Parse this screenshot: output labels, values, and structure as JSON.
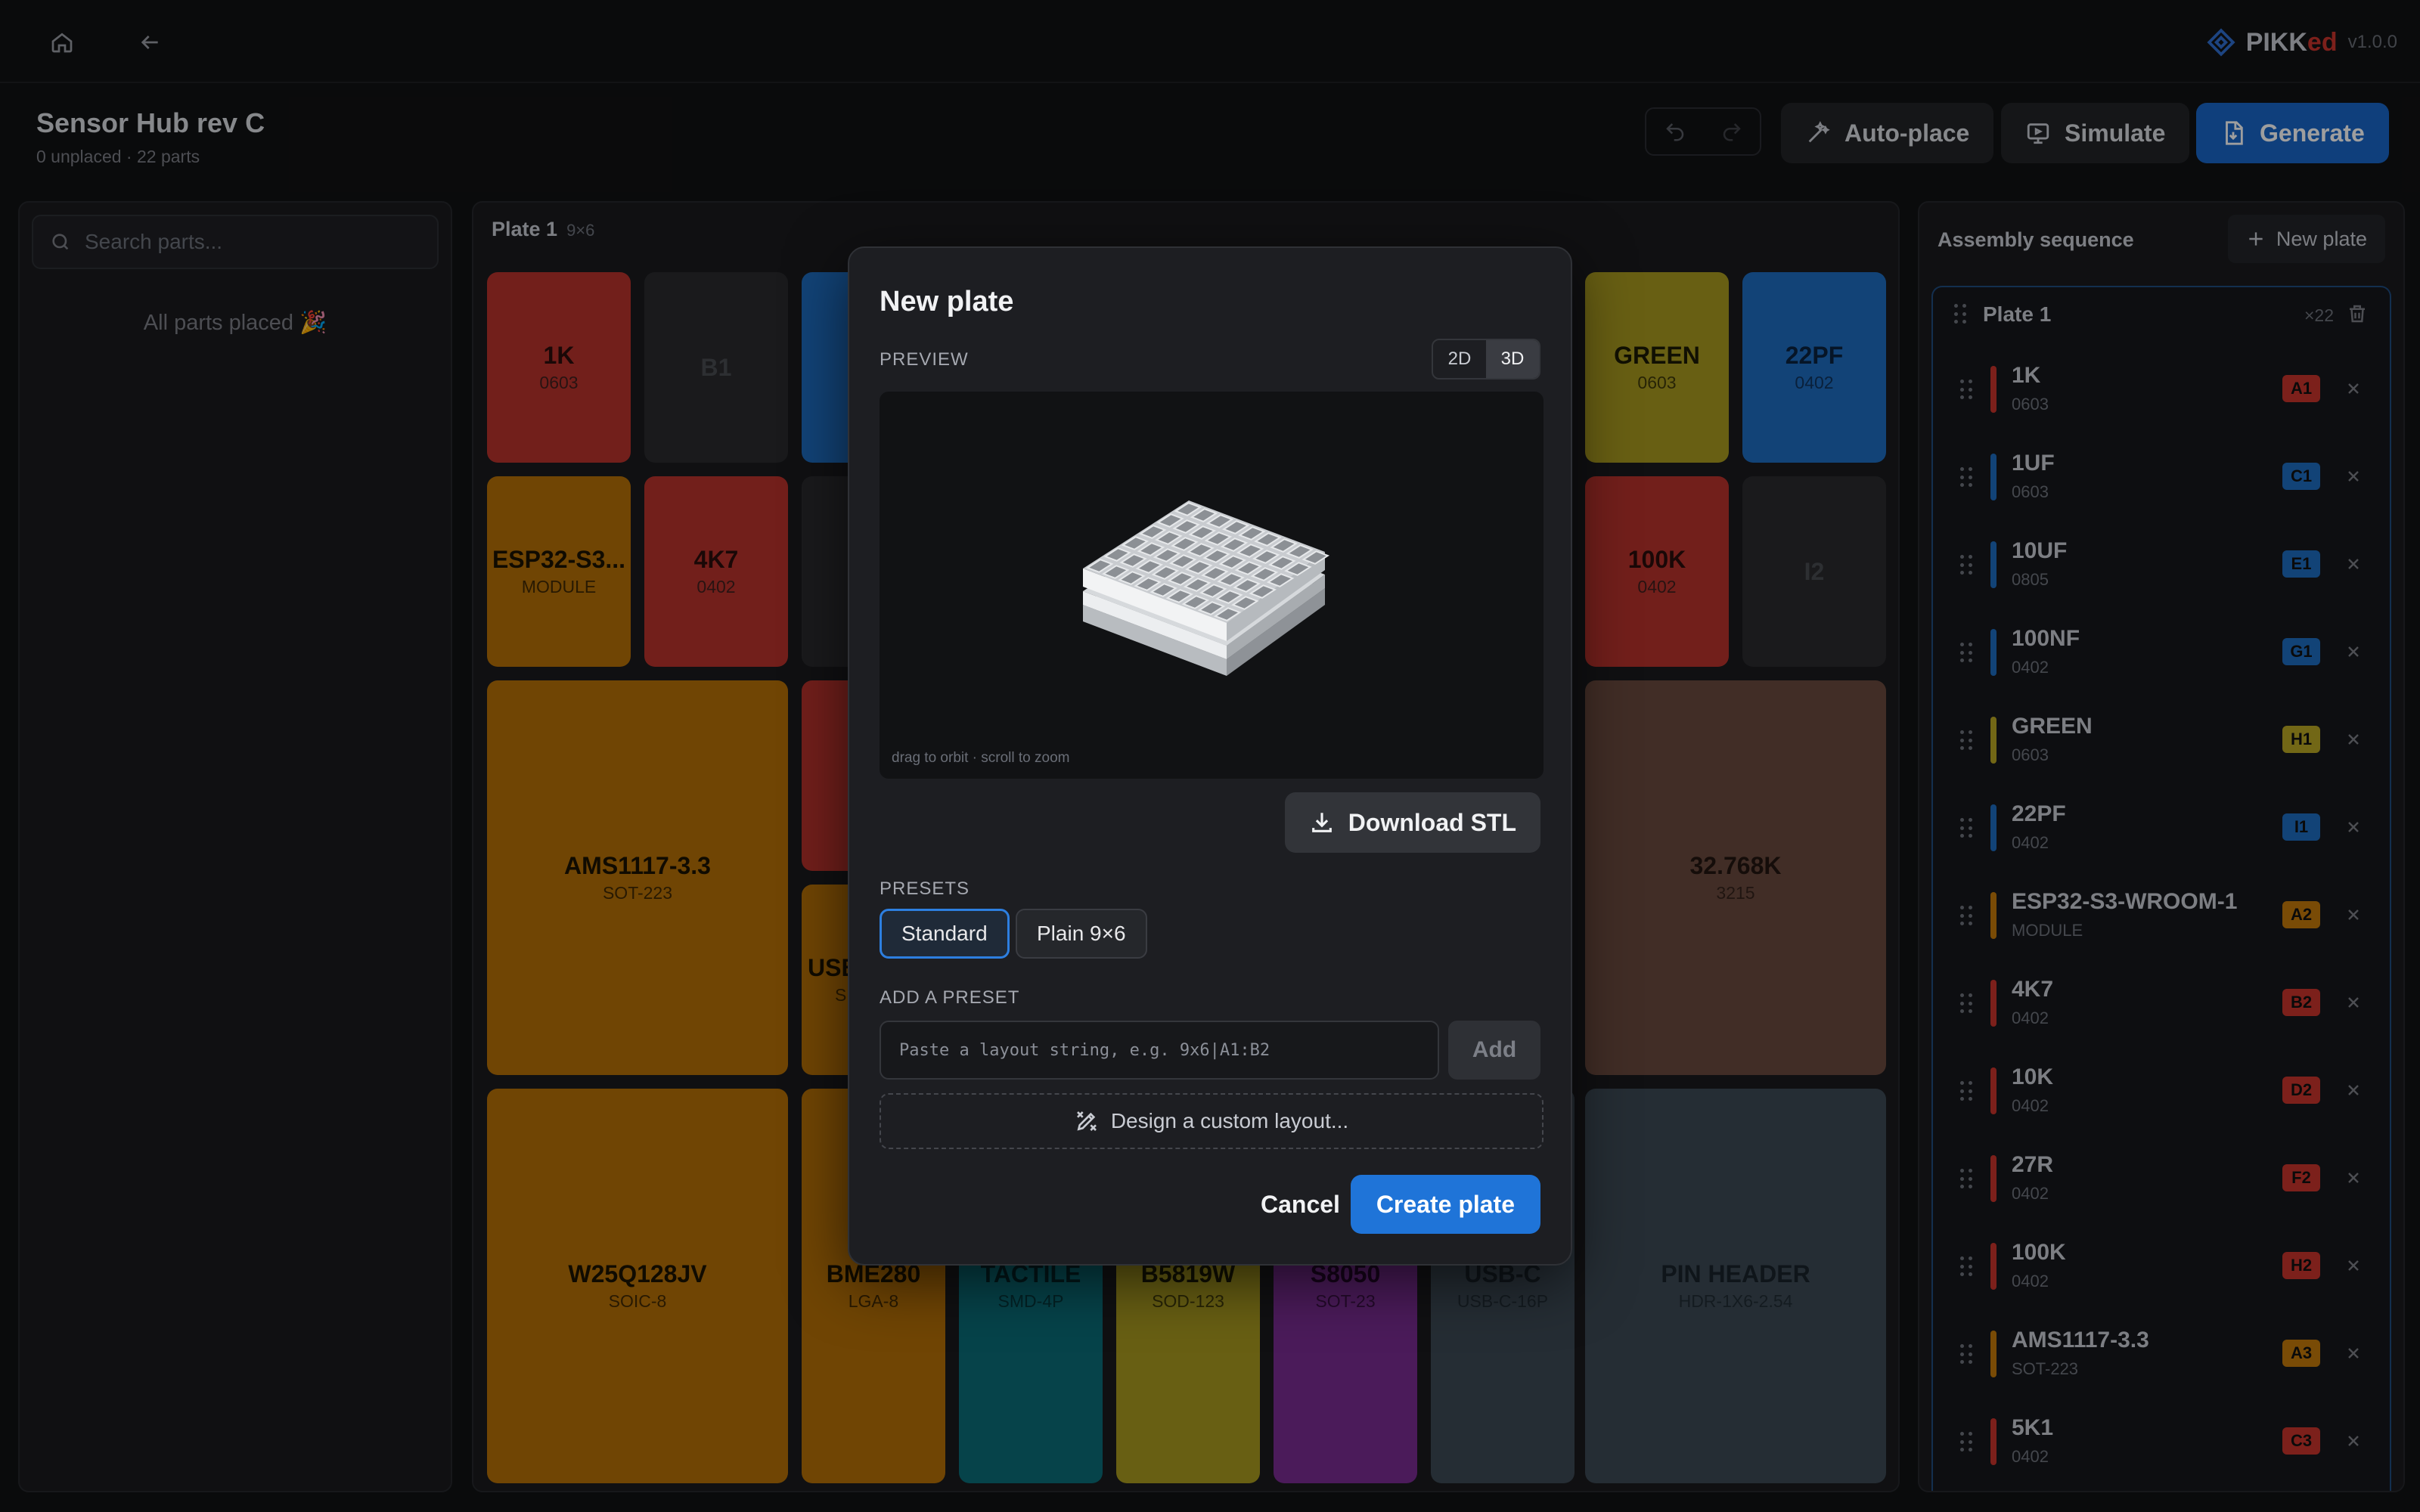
{
  "brand": {
    "name_main": "PIKK",
    "name_accent": "ed",
    "version": "v1.0.0"
  },
  "project": {
    "title": "Sensor Hub rev C",
    "subtitle": "0 unplaced · 22 parts"
  },
  "toolbar": {
    "auto_place": "Auto-place",
    "simulate": "Simulate",
    "generate": "Generate"
  },
  "parts_panel": {
    "search_placeholder": "Search parts...",
    "empty_message": "All parts placed 🎉"
  },
  "plate": {
    "name": "Plate 1",
    "size": "9×6",
    "cells": [
      {
        "name": "1K",
        "pkg": "0603"
      },
      {
        "name": "B1",
        "pkg": ""
      },
      {
        "name": "GREEN",
        "pkg": "0603"
      },
      {
        "name": "22PF",
        "pkg": "0402"
      },
      {
        "name": "ESP32-S3...",
        "pkg": "MODULE"
      },
      {
        "name": "4K7",
        "pkg": "0402"
      },
      {
        "name": "100K",
        "pkg": "0402"
      },
      {
        "name": "I2",
        "pkg": ""
      },
      {
        "name": "AMS1117-3.3",
        "pkg": "SOT-223"
      },
      {
        "name": "USB",
        "pkg": "S"
      },
      {
        "name": "32.768K",
        "pkg": "3215"
      },
      {
        "name": "W25Q128JV",
        "pkg": "SOIC-8"
      },
      {
        "name": "BME280",
        "pkg": "LGA-8"
      },
      {
        "name": "TACTILE",
        "pkg": "SMD-4P"
      },
      {
        "name": "B5819W",
        "pkg": "SOD-123"
      },
      {
        "name": "S8050",
        "pkg": "SOT-23"
      },
      {
        "name": "USB-C",
        "pkg": "USB-C-16P"
      },
      {
        "name": "PIN HEADER",
        "pkg": "HDR-1X6-2.54"
      }
    ]
  },
  "sequence": {
    "title": "Assembly sequence",
    "new_plate": "New plate",
    "plate_name": "Plate 1",
    "plate_count": "×22",
    "items": [
      {
        "name": "1K",
        "pkg": "0603",
        "slot": "A1",
        "color": "#c8342d"
      },
      {
        "name": "1UF",
        "pkg": "0603",
        "slot": "C1",
        "color": "#1e6cc0"
      },
      {
        "name": "10UF",
        "pkg": "0805",
        "slot": "E1",
        "color": "#1e6cc0"
      },
      {
        "name": "100NF",
        "pkg": "0402",
        "slot": "G1",
        "color": "#1e6cc0"
      },
      {
        "name": "GREEN",
        "pkg": "0603",
        "slot": "H1",
        "color": "#b9a724"
      },
      {
        "name": "22PF",
        "pkg": "0402",
        "slot": "I1",
        "color": "#1e6cc0"
      },
      {
        "name": "ESP32-S3-WROOM-1",
        "pkg": "MODULE",
        "slot": "A2",
        "color": "#c47a0a"
      },
      {
        "name": "4K7",
        "pkg": "0402",
        "slot": "B2",
        "color": "#c8342d"
      },
      {
        "name": "10K",
        "pkg": "0402",
        "slot": "D2",
        "color": "#c8342d"
      },
      {
        "name": "27R",
        "pkg": "0402",
        "slot": "F2",
        "color": "#c8342d"
      },
      {
        "name": "100K",
        "pkg": "0402",
        "slot": "H2",
        "color": "#c8342d"
      },
      {
        "name": "AMS1117-3.3",
        "pkg": "SOT-223",
        "slot": "A3",
        "color": "#c47a0a"
      },
      {
        "name": "5K1",
        "pkg": "0402",
        "slot": "C3",
        "color": "#c8342d"
      }
    ]
  },
  "modal": {
    "title": "New plate",
    "preview_label": "PREVIEW",
    "view_2d": "2D",
    "view_3d": "3D",
    "preview_hint": "drag to orbit · scroll to zoom",
    "download": "Download STL",
    "presets_label": "PRESETS",
    "presets": [
      "Standard",
      "Plain 9×6"
    ],
    "add_preset_label": "ADD A PRESET",
    "layout_placeholder": "Paste a layout string, e.g. 9x6|A1:B2",
    "add": "Add",
    "design": "Design a custom layout...",
    "cancel": "Cancel",
    "create": "Create plate"
  },
  "icons": [
    "home-icon",
    "back-arrow-icon",
    "logo-icon",
    "undo-icon",
    "redo-icon",
    "wand-icon",
    "monitor-icon",
    "file-icon",
    "search-icon",
    "plus-icon",
    "trash-icon",
    "drag-handle-icon",
    "close-icon",
    "download-icon",
    "design-icon"
  ]
}
